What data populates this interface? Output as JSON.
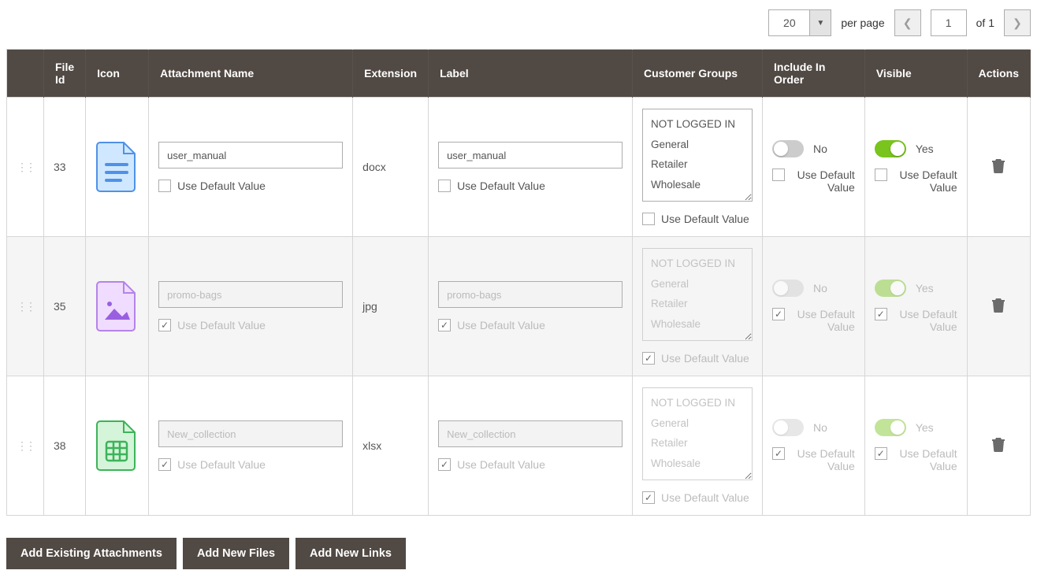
{
  "pager": {
    "page_size": "20",
    "per_page_label": "per page",
    "current": "1",
    "of_label": "of",
    "total": "1"
  },
  "cols": {
    "drag": "",
    "file_id": "File Id",
    "icon": "Icon",
    "name": "Attachment Name",
    "ext": "Extension",
    "label": "Label",
    "cg": "Customer Groups",
    "order": "Include In Order",
    "visible": "Visible",
    "actions": "Actions"
  },
  "udv_label": "Use Default Value",
  "toggle": {
    "yes": "Yes",
    "no": "No"
  },
  "cg_options": [
    "NOT LOGGED IN",
    "General",
    "Retailer",
    "Wholesale"
  ],
  "rows": [
    {
      "id": "33",
      "name": "user_manual",
      "ext": "docx",
      "label": "user_manual",
      "default": false,
      "include_in_order": false,
      "visible": true
    },
    {
      "id": "35",
      "name": "promo-bags",
      "ext": "jpg",
      "label": "promo-bags",
      "default": true,
      "include_in_order": false,
      "visible": true
    },
    {
      "id": "38",
      "name": "New_collection",
      "ext": "xlsx",
      "label": "New_collection",
      "default": true,
      "include_in_order": false,
      "visible": true
    }
  ],
  "buttons": {
    "existing": "Add Existing Attachments",
    "files": "Add New Files",
    "links": "Add New Links"
  }
}
